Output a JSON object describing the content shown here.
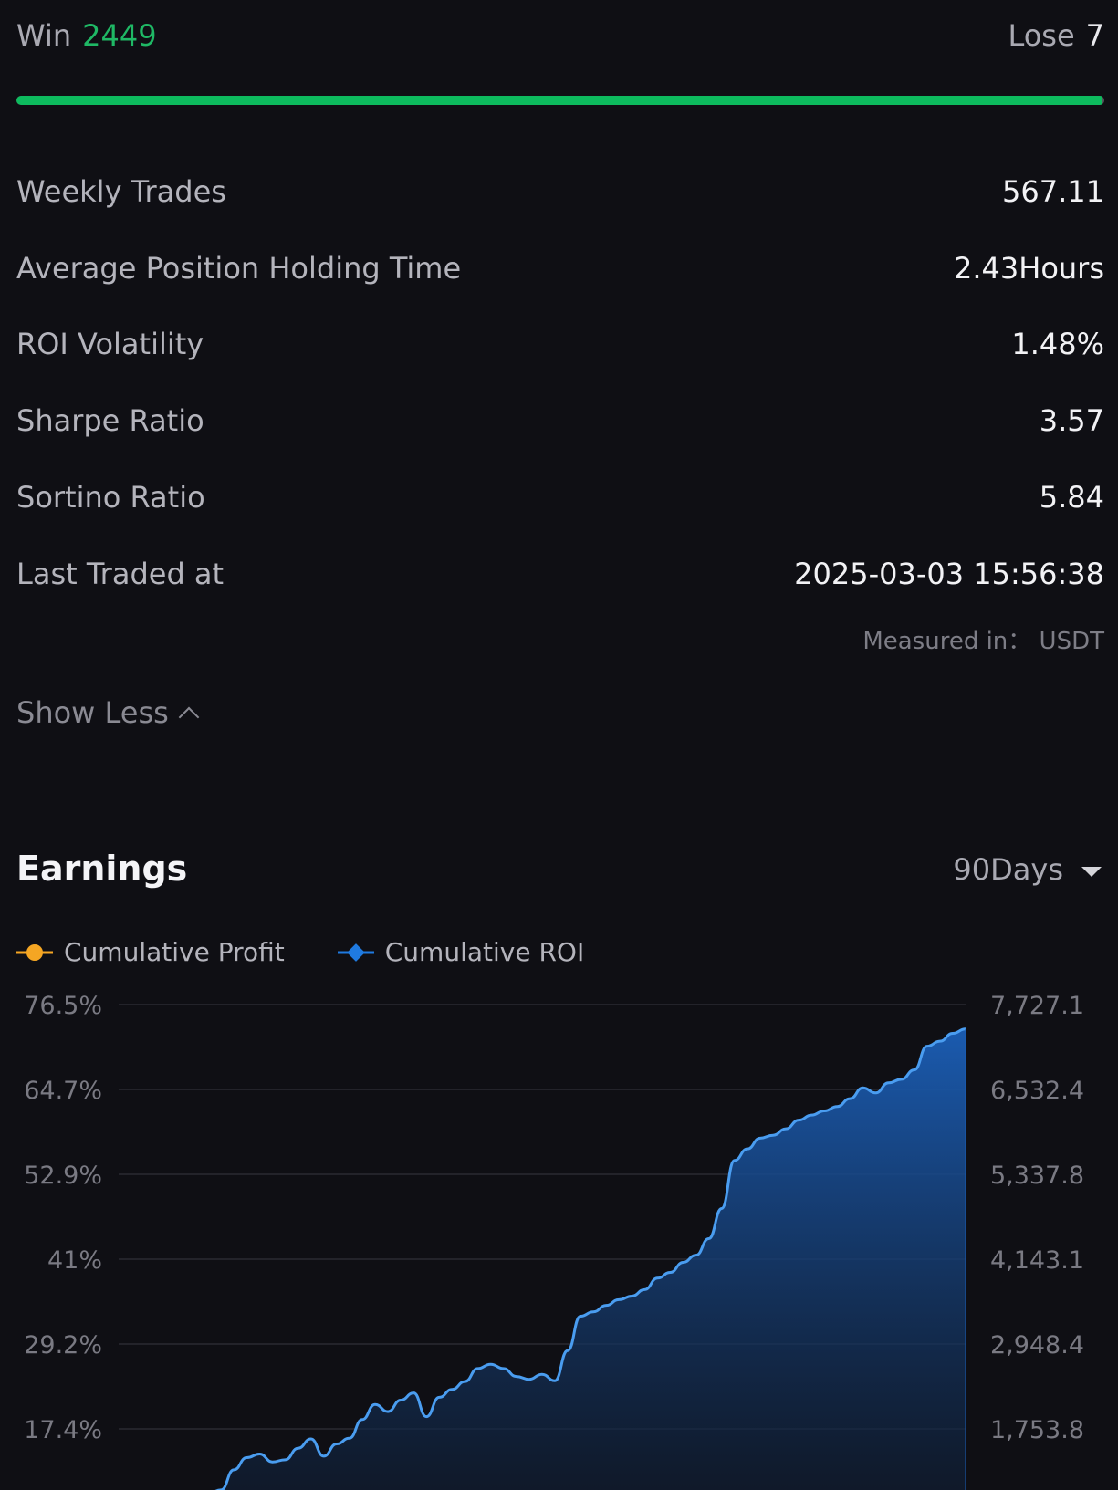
{
  "summary": {
    "win_label": "Win",
    "win_value": "2449",
    "lose_label": "Lose",
    "lose_value": "7",
    "win_ratio": 0.9971
  },
  "stats": [
    {
      "label": "Weekly Trades",
      "value": "567.11"
    },
    {
      "label": "Average Position Holding Time",
      "value": "2.43Hours"
    },
    {
      "label": "ROI Volatility",
      "value": "1.48%"
    },
    {
      "label": "Sharpe Ratio",
      "value": "3.57"
    },
    {
      "label": "Sortino Ratio",
      "value": "5.84"
    },
    {
      "label": "Last Traded at",
      "value": "2025-03-03 15:56:38"
    }
  ],
  "measured": "Measured in： USDT",
  "show_less": "Show Less",
  "earnings": {
    "title": "Earnings",
    "period": "90Days"
  },
  "colors": {
    "win": "#1fb865",
    "profit": "#f5a623",
    "roi": "#1f7ae0",
    "roi_line": "#4a9df0"
  },
  "chart_data": {
    "type": "area",
    "legend": [
      "Cumulative Profit",
      "Cumulative ROI"
    ],
    "left_ticks": [
      "76.5%",
      "64.7%",
      "52.9%",
      "41%",
      "29.2%",
      "17.4%"
    ],
    "right_ticks": [
      "7,727.1",
      "6,532.4",
      "5,337.8",
      "4,143.1",
      "2,948.4",
      "1,753.8"
    ],
    "ylim": [
      17.4,
      76.5
    ],
    "series": [
      {
        "name": "Cumulative ROI",
        "values": [
          5.1,
          7.6,
          8.4,
          8.9,
          11.7,
          13.4,
          13.9,
          12.8,
          13.1,
          14.7,
          16.0,
          13.6,
          15.3,
          16.1,
          18.7,
          20.8,
          19.8,
          21.4,
          22.4,
          19.1,
          21.8,
          22.9,
          24.0,
          25.8,
          26.4,
          25.8,
          24.7,
          24.3,
          25.0,
          24.1,
          28.3,
          33.1,
          33.7,
          34.6,
          35.4,
          35.9,
          36.8,
          38.4,
          39.2,
          40.6,
          41.6,
          43.9,
          48.1,
          54.8,
          56.4,
          57.9,
          58.3,
          59.2,
          60.4,
          61.1,
          61.7,
          62.3,
          63.4,
          64.9,
          64.2,
          65.6,
          66.1,
          67.4,
          70.7,
          71.4,
          72.5,
          73.1
        ]
      }
    ]
  }
}
